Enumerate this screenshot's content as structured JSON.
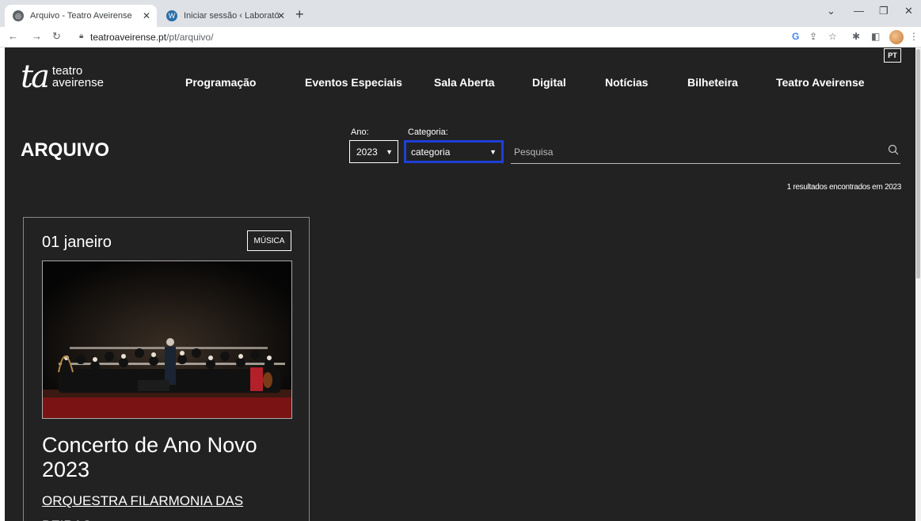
{
  "browser": {
    "tabs": [
      {
        "title": "Arquivo - Teatro Aveirense",
        "active": true
      },
      {
        "title": "Iniciar sessão ‹ Laboratório de Ar",
        "active": false
      }
    ],
    "url_domain": "teatroaveirense.pt",
    "url_path": "/pt/arquivo/"
  },
  "site": {
    "logo_mark": "ta",
    "logo_line1": "teatro",
    "logo_line2": "aveirense",
    "nav": [
      "Programação",
      "Eventos Especiais",
      "Sala Aberta",
      "Digital",
      "Notícias",
      "Bilheteira",
      "Teatro Aveirense"
    ],
    "language": "PT"
  },
  "archive": {
    "title": "ARQUIVO",
    "year_label": "Ano:",
    "year_value": "2023",
    "category_label": "Categoria:",
    "category_value": "categoria",
    "search_placeholder": "Pesquisa",
    "results_text": "1 resultados encontrados em 2023"
  },
  "event": {
    "date": "01 janeiro",
    "category": "MÚSICA",
    "title": "Concerto de Ano Novo 2023",
    "subtitle": "ORQUESTRA FILARMONIA DAS BEIRAS"
  },
  "colors": {
    "page_bg": "#222222",
    "focus_ring": "#1f3fd6"
  }
}
